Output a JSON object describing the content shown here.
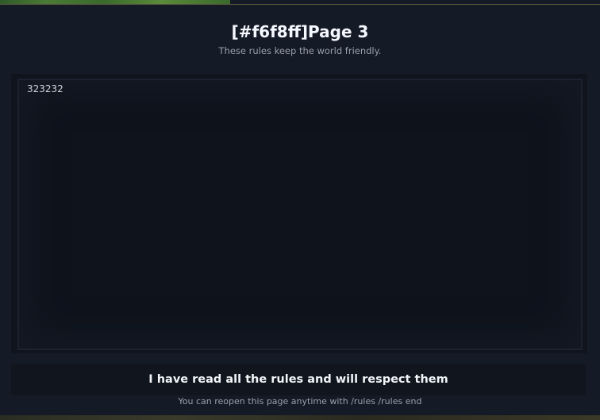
{
  "dialog": {
    "title": "[#f6f8ff]Page 3",
    "subtitle": "These rules keep the world friendly.",
    "content_text": "323232",
    "accept_button_label": "I have read all the rules and will respect them",
    "footer_note": "You can reopen this page anytime with /rules /rules end"
  },
  "colors": {
    "background": "#151b26",
    "title": "#f6f8ff",
    "subtitle": "#9aa0aa",
    "content_panel": "#0e131c",
    "button": "#10151e"
  }
}
